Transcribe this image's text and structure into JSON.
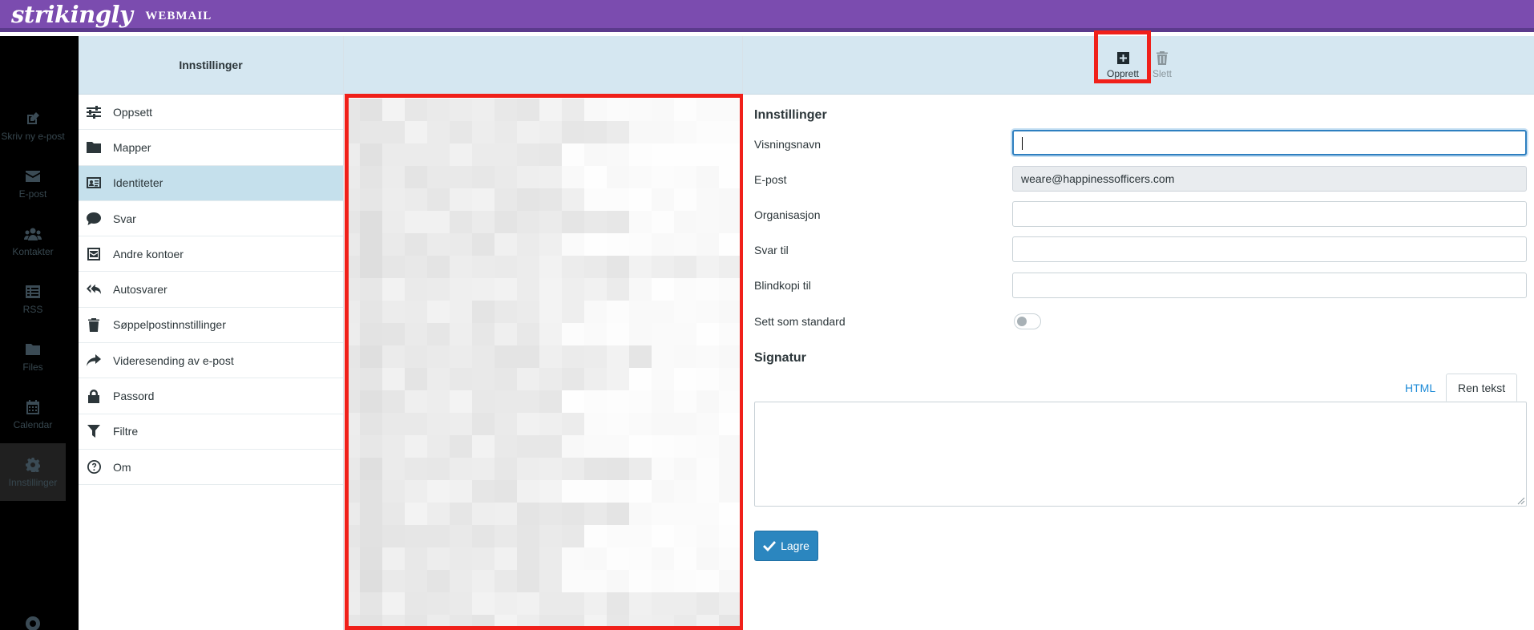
{
  "brand": {
    "logo": "strikingly",
    "product": "WEBMAIL"
  },
  "leftnav": {
    "items": [
      {
        "label": "Skriv ny e-post",
        "icon": "compose-icon"
      },
      {
        "label": "E-post",
        "icon": "envelope-icon"
      },
      {
        "label": "Kontakter",
        "icon": "users-icon"
      },
      {
        "label": "RSS",
        "icon": "list-icon"
      },
      {
        "label": "Files",
        "icon": "folder-icon"
      },
      {
        "label": "Calendar",
        "icon": "calendar-icon"
      },
      {
        "label": "Innstillinger",
        "icon": "gear-icon",
        "active": true
      }
    ]
  },
  "settings": {
    "header": "Innstillinger",
    "items": [
      {
        "label": "Oppsett",
        "icon": "sliders-icon"
      },
      {
        "label": "Mapper",
        "icon": "folder-icon"
      },
      {
        "label": "Identiteter",
        "icon": "id-card-icon",
        "active": true
      },
      {
        "label": "Svar",
        "icon": "comment-icon"
      },
      {
        "label": "Andre kontoer",
        "icon": "envelope-square-icon"
      },
      {
        "label": "Autosvarer",
        "icon": "reply-all-icon"
      },
      {
        "label": "Søppelpostinnstillinger",
        "icon": "trash-icon"
      },
      {
        "label": "Videresending av e-post",
        "icon": "share-icon"
      },
      {
        "label": "Passord",
        "icon": "lock-icon"
      },
      {
        "label": "Filtre",
        "icon": "filter-icon"
      },
      {
        "label": "Om",
        "icon": "question-circle-icon"
      }
    ]
  },
  "toolbar": {
    "create_label": "Opprett",
    "delete_label": "Slett"
  },
  "form": {
    "section_title": "Innstillinger",
    "fields": {
      "display_name": {
        "label": "Visningsnavn",
        "value": ""
      },
      "email": {
        "label": "E-post",
        "value": "weare@happinessofficers.com"
      },
      "organization": {
        "label": "Organisasjon",
        "value": ""
      },
      "reply_to": {
        "label": "Svar til",
        "value": ""
      },
      "bcc": {
        "label": "Blindkopi til",
        "value": ""
      },
      "set_default": {
        "label": "Sett som standard",
        "on": false
      }
    },
    "signature": {
      "title": "Signatur",
      "tabs": {
        "html": "HTML",
        "text": "Ren tekst"
      },
      "value": ""
    },
    "save_label": "Lagre"
  },
  "colors": {
    "topbar": "#7b4caf",
    "panel_header": "#d5e7f1",
    "active_item": "#c5e0ec",
    "accent_button": "#2b86bf",
    "highlight_frame": "#f0201a"
  }
}
